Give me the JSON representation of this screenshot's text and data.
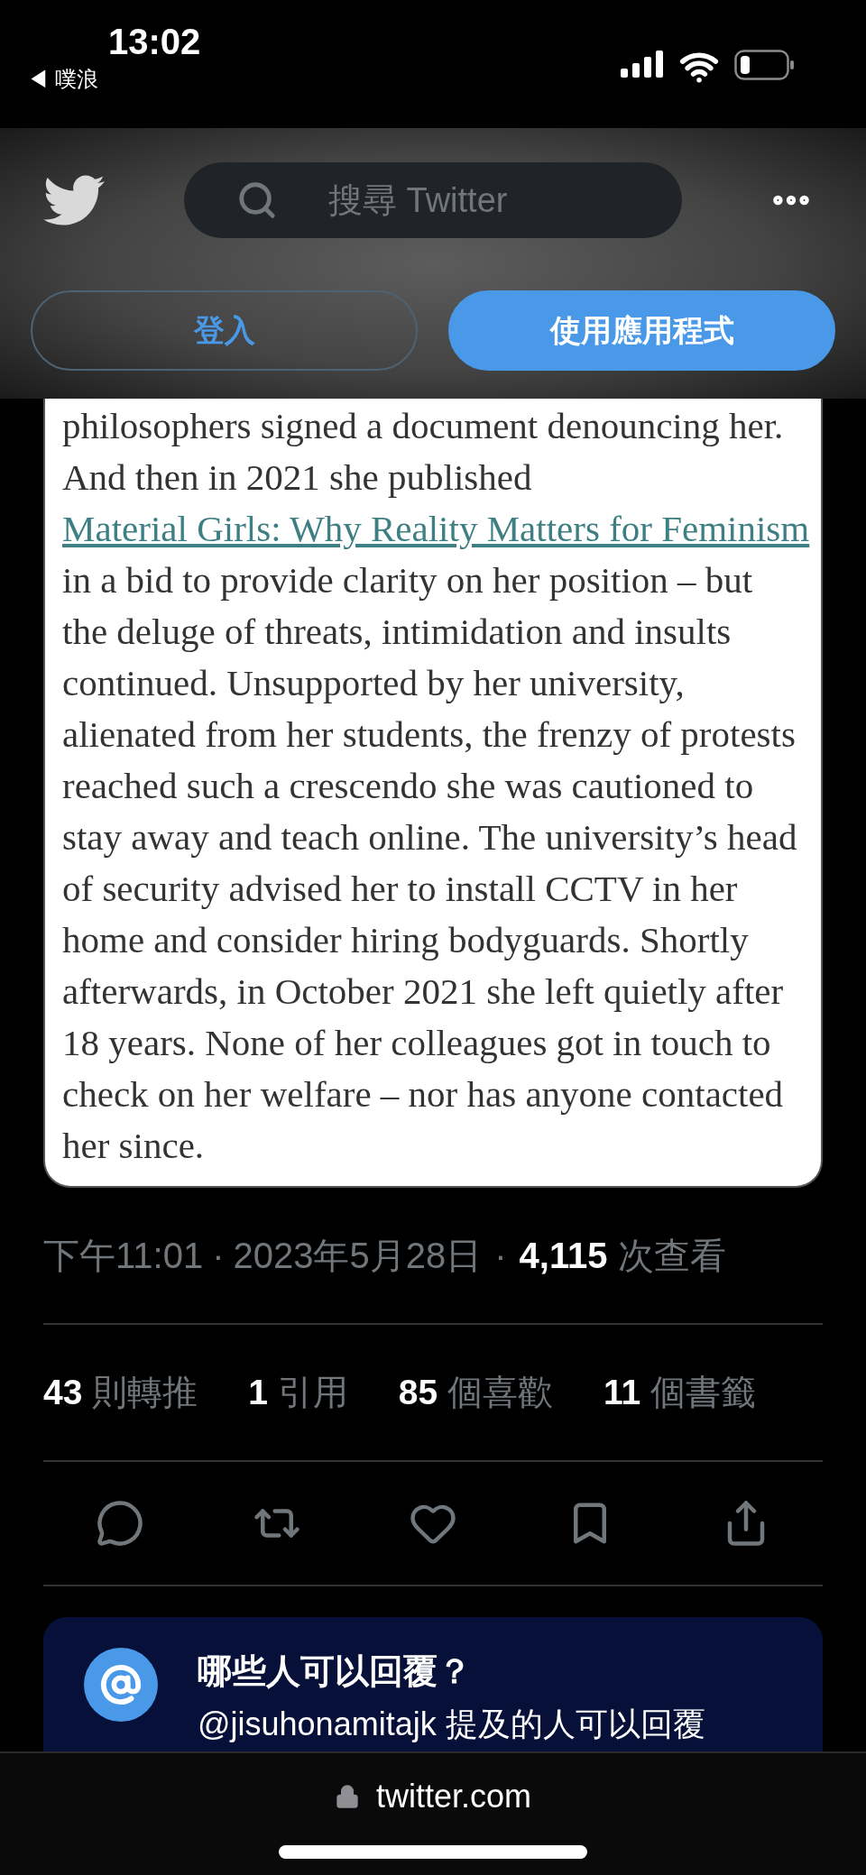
{
  "status_bar": {
    "time": "13:02",
    "back_app": "◀ 噗浪"
  },
  "header": {
    "search": {
      "placeholder": "搜尋 Twitter"
    },
    "buttons": [
      {
        "label": "登入",
        "kind": "outline"
      },
      {
        "label": "使用應用程式",
        "kind": "primary"
      }
    ]
  },
  "article": {
    "segments": [
      {
        "kind": "text",
        "text": "philosophers signed a document denouncing her. And then in 2021 she published"
      },
      {
        "kind": "link",
        "text": "Material Girls: Why Reality Matters for Feminism"
      },
      {
        "kind": "text",
        "text": "in a bid to provide clarity on her position – but the deluge of threats, intimidation and insults continued. Unsupported by her university, alienated from her students, the frenzy of protests reached such a crescendo she was cautioned to stay away and teach online. The university’s head of security advised her to install CCTV in her home and consider hiring bodyguards. Shortly afterwards, in October 2021 she left quietly after 18 years. None of her colleagues got in touch to check on her welfare – nor has anyone contacted her since."
      }
    ]
  },
  "meta": {
    "time": "下午11:01",
    "separator_1": "·",
    "date": "2023年5月28日",
    "separator_2": "·",
    "views_count": "4,115",
    "views_label": "次查看"
  },
  "stats": [
    {
      "count": "43",
      "label": "則轉推"
    },
    {
      "count": "1",
      "label": "引用"
    },
    {
      "count": "85",
      "label": "個喜歡"
    },
    {
      "count": "11",
      "label": "個書籤"
    }
  ],
  "actions": [
    {
      "kind": "reply"
    },
    {
      "kind": "retweet"
    },
    {
      "kind": "like"
    },
    {
      "kind": "bookmark"
    },
    {
      "kind": "share"
    }
  ],
  "reply_settings": {
    "title": "哪些人可以回覆？",
    "subtitle": "@jisuhonamitajk 提及的人可以回覆"
  },
  "browser_bar": {
    "url": "twitter.com"
  }
}
